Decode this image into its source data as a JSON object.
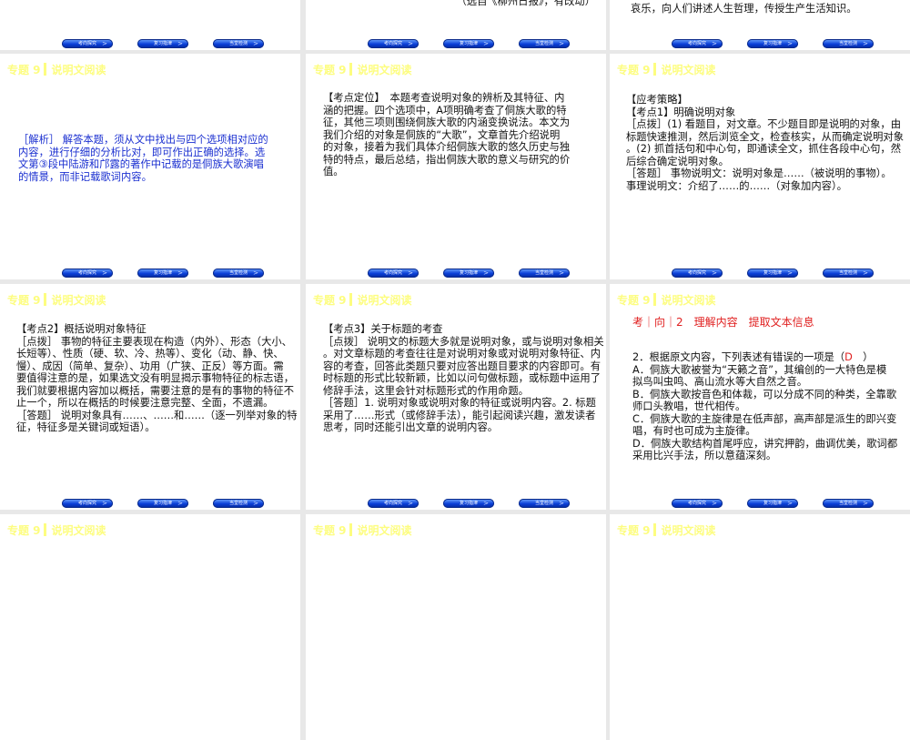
{
  "header": {
    "topic": "专题 9",
    "title": "说明文阅读"
  },
  "buttons": [
    "考向探究",
    "复习指津",
    "当堂检测"
  ],
  "button_arrow": ">",
  "slides": {
    "top_mid": {
      "source": "（选自《柳州日报》，有改动）"
    },
    "top_right": {
      "lines": [
        "哀乐，向人们讲述人生哲理，传授生产生活知识。"
      ]
    },
    "analysis": {
      "lines": [
        "［解析］ 解答本题，须从文中找出与四个选项相对应的",
        "内容，进行仔细的分析比对，即可作出正确的选择。选",
        "文第③段中陆游和邝露的著作中记载的是侗族大歌演唱",
        "的情景，而非记载歌词内容。"
      ]
    },
    "positioning": {
      "lines": [
        "【考点定位】　本题考查说明对象的辨析及其特征、内",
        "涵的把握。四个选项中，A项明确考查了侗族大歌的特",
        "征，其他三项则围绕侗族大歌的内涵变换说法。本文为",
        "我们介绍的对象是侗族的“大歌”，文章首先介绍说明",
        "的对象，接着为我们具体介绍侗族大歌的悠久历史与独",
        "特的特点，最后总结，指出侗族大歌的意义与研究的价",
        "值。"
      ]
    },
    "strategy1": {
      "lines": [
        "【应考策略】",
        "【考点1】明确说明对象",
        "［点拨］(1) 看题目，对文章。不少题目即是说明的对象，由",
        "标题快速推测，然后浏览全文，检查核实，从而确定说明对象",
        "。(2) 抓首括句和中心句，即通读全文，抓住各段中心句，然",
        "后综合确定说明对象。",
        "［答题］ 事物说明文：说明对象是……（被说明的事物）。",
        "事理说明文：介绍了……的……（对象加内容）。"
      ]
    },
    "strategy2": {
      "lines": [
        "【考点2】概括说明对象特征",
        "［点拨］ 事物的特征主要表现在构造（内外）、形态（大小、",
        "长短等）、性质（硬、软、冷、热等）、变化（动、静、快、",
        "慢）、成因（简单、复杂）、功用（广狭、正反）等方面。需",
        "要值得注意的是，如果选文没有明显揭示事物特征的标志语，",
        "我们就要根据内容加以概括，需要注意的是有的事物的特征不",
        "止一个，所以在概括的时候要注意完整、全面，不遗漏。",
        "［答题］ 说明对象具有……、……和……（逐一列举对象的特",
        "征，特征多是关键词或短语）。"
      ]
    },
    "strategy3": {
      "lines": [
        "【考点3】关于标题的考查",
        "［点拨］ 说明文的标题大多就是说明对象，或与说明对象相关",
        "。对文章标题的考查往往是对说明对象或对说明对象特征、内",
        "容的考查，回答此类题只要对应答出题目要求的内容即可。有",
        "时标题的形式比较新颖，比如以问句做标题，或标题中运用了",
        "修辞手法，这里会针对标题形式的作用命题。",
        "［答题］1. 说明对象或说明对象的特征或说明内容。2. 标题",
        "采用了……形式（或修辞手法），能引起阅读兴趣，激发读者",
        "思考，同时还能引出文章的说明内容。"
      ]
    },
    "question": {
      "section": "考｜向｜2　理解内容　提取文本信息",
      "stem_prefix": "2．根据原文内容，下列表述有错误的一项是（",
      "answer": "D",
      "stem_suffix": "　）",
      "lines": [
        "A．侗族大歌被誉为“天籁之音”，其编创的一大特色是模",
        "拟鸟叫虫鸣、高山流水等大自然之音。",
        "B．侗族大歌按音色和体裁，可以分成不同的种类，全靠歌",
        "师口头教唱，世代相传。",
        "C．侗族大歌的主旋律是在低声部，高声部是派生的即兴变",
        "唱，有时也可成为主旋律。",
        "D．侗族大歌结构首尾呼应，讲究押韵，曲调优美，歌词都",
        "采用比兴手法，所以意蕴深刻。"
      ]
    }
  },
  "colors": {
    "header": "#fdfd80",
    "analysis_text": "#1a2fd0",
    "answer": "#e02020",
    "button": "#0a3ed8"
  }
}
